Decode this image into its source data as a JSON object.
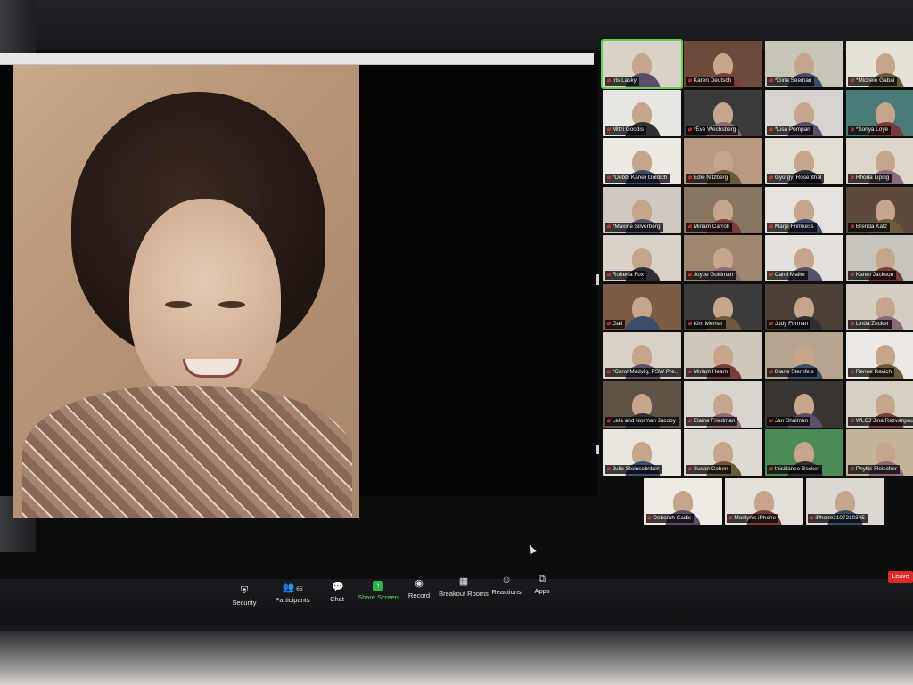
{
  "participants_tiles": [
    {
      "name": "Iris Lasky",
      "col": 0,
      "row": 0,
      "bg": "#d9d2c6",
      "active": true
    },
    {
      "name": "Karen Deutsch",
      "col": 1,
      "row": 0,
      "bg": "#6e4a3b"
    },
    {
      "name": "*Gina Seeman",
      "col": 2,
      "row": 0,
      "bg": "#c9c4b8"
    },
    {
      "name": "*Michele Gabai",
      "col": 3,
      "row": 0,
      "bg": "#e6e2d8"
    },
    {
      "name": "Mitzi Goodis",
      "col": 0,
      "row": 1,
      "bg": "#e8e6e2"
    },
    {
      "name": "*Eve Wechsberg",
      "col": 1,
      "row": 1,
      "bg": "#3d3b3a"
    },
    {
      "name": "*Lisa Pompan",
      "col": 2,
      "row": 1,
      "bg": "#d7d4cf"
    },
    {
      "name": "*Sonya Loye",
      "col": 3,
      "row": 1,
      "bg": "#4b7b77"
    },
    {
      "name": "*Debbi Kaner Goldich",
      "col": 0,
      "row": 2,
      "bg": "#ece8e2"
    },
    {
      "name": "Edie Nitzberg",
      "col": 1,
      "row": 2,
      "bg": "#b89a82"
    },
    {
      "name": "Gyorgyi Rosenthal",
      "col": 2,
      "row": 2,
      "bg": "#e2ddd3"
    },
    {
      "name": "Rhoda Lipsig",
      "col": 3,
      "row": 2,
      "bg": "#dcd6cb"
    },
    {
      "name": "*Maxine Silverberg",
      "col": 0,
      "row": 3,
      "bg": "#cfc9c2"
    },
    {
      "name": "Miriam Carroll",
      "col": 1,
      "row": 3,
      "bg": "#8a7560"
    },
    {
      "name": "Marje Frimkess",
      "col": 2,
      "row": 3,
      "bg": "#e6e3de"
    },
    {
      "name": "Brenda Katz",
      "col": 3,
      "row": 3,
      "bg": "#5d4a3c"
    },
    {
      "name": "Roberta Fox",
      "col": 0,
      "row": 4,
      "bg": "#d8d2c8"
    },
    {
      "name": "Joyce Goldman",
      "col": 1,
      "row": 4,
      "bg": "#9e8670"
    },
    {
      "name": "Carol Maller",
      "col": 2,
      "row": 4,
      "bg": "#e4e1dc"
    },
    {
      "name": "Karen Jackson",
      "col": 3,
      "row": 4,
      "bg": "#c7c3bd"
    },
    {
      "name": "Gail",
      "col": 0,
      "row": 5,
      "bg": "#7b5d44"
    },
    {
      "name": "Kim Memar",
      "col": 1,
      "row": 5,
      "bg": "#3d3a3a"
    },
    {
      "name": "Judy Forman",
      "col": 2,
      "row": 5,
      "bg": "#4d4038"
    },
    {
      "name": "Linda Zucker",
      "col": 3,
      "row": 5,
      "bg": "#d4cdc4"
    },
    {
      "name": "*Carol Madvig, PSW Pre...",
      "col": 0,
      "row": 6,
      "bg": "#d9d0c7"
    },
    {
      "name": "Miriam Hearn",
      "col": 1,
      "row": 6,
      "bg": "#cfc7bc"
    },
    {
      "name": "Diane Sternfels",
      "col": 2,
      "row": 6,
      "bg": "#b7a58f"
    },
    {
      "name": "Renee Ravich",
      "col": 3,
      "row": 6,
      "bg": "#ece9e4"
    },
    {
      "name": "Lela and Norman Jacoby",
      "col": 0,
      "row": 7,
      "bg": "#5f5347"
    },
    {
      "name": "Elaine Friedman",
      "col": 1,
      "row": 7,
      "bg": "#d9d5ce"
    },
    {
      "name": "Jan Shulman",
      "col": 2,
      "row": 7,
      "bg": "#3a3532"
    },
    {
      "name": "WLCJ Jina Rezvanpour",
      "col": 3,
      "row": 7,
      "bg": "#d6d0c6"
    },
    {
      "name": "Julie Steinschriber",
      "col": 0,
      "row": 8,
      "bg": "#e9e5df"
    },
    {
      "name": "Susan Cohen",
      "col": 1,
      "row": 8,
      "bg": "#dedad2"
    },
    {
      "name": "thisillanee Becker",
      "col": 2,
      "row": 8,
      "bg": "#4d8a55"
    },
    {
      "name": "Phyllis Fleischer",
      "col": 3,
      "row": 8,
      "bg": "#c4b29a"
    },
    {
      "name": "Deborah Cadis",
      "col": 0.5,
      "row": 9,
      "bg": "#efeae4"
    },
    {
      "name": "Marilyn's iPhone",
      "col": 1.5,
      "row": 9,
      "bg": "#e3dfd9"
    },
    {
      "name": "iPhone3107210345",
      "col": 2.5,
      "row": 9,
      "bg": "#dcd7d0"
    }
  ],
  "toolbar": {
    "security": "Security",
    "participants": "Participants",
    "participants_count": "65",
    "chat": "Chat",
    "share_screen": "Share Screen",
    "record": "Record",
    "breakout_rooms": "Breakout Rooms",
    "reactions": "Reactions",
    "apps": "Apps"
  },
  "leave_label": "Leave",
  "icons": {
    "security": "shield-icon",
    "participants": "people-icon",
    "chat": "chat-bubble-icon",
    "share_screen": "share-arrow-icon",
    "record": "record-circle-icon",
    "breakout_rooms": "grid-icon",
    "reactions": "smiley-icon",
    "apps": "apps-icon"
  },
  "colors": {
    "active_speaker": "#62d04a",
    "share_green": "#2fb24a",
    "leave_red": "#e02b2b",
    "mic_muted": "#ff3b30"
  }
}
